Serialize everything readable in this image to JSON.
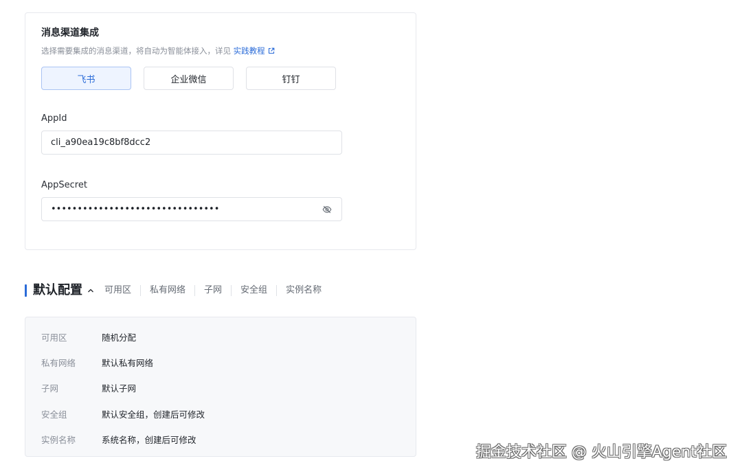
{
  "channel_card": {
    "title": "消息渠道集成",
    "description": "选择需要集成的消息渠道，将自动为智能体接入，详见",
    "tutorial_link": "实践教程",
    "tabs": [
      {
        "label": "飞书",
        "active": true
      },
      {
        "label": "企业微信",
        "active": false
      },
      {
        "label": "钉钉",
        "active": false
      }
    ],
    "app_id": {
      "label": "AppId",
      "value": "cli_a90ea19c8bf8dcc2"
    },
    "app_secret": {
      "label": "AppSecret",
      "masked_value": "••••••••••••••••••••••••••••••••"
    }
  },
  "default_config": {
    "title": "默认配置",
    "summary_items": [
      "可用区",
      "私有网络",
      "子网",
      "安全组",
      "实例名称"
    ],
    "rows": [
      {
        "key": "可用区",
        "value": "随机分配"
      },
      {
        "key": "私有网络",
        "value": "默认私有网络"
      },
      {
        "key": "子网",
        "value": "默认子网"
      },
      {
        "key": "安全组",
        "value": "默认安全组，创建后可修改"
      },
      {
        "key": "实例名称",
        "value": "系统名称，创建后可修改"
      }
    ]
  },
  "watermark": "掘金技术社区 @ 火山引擎Agent社区",
  "colors": {
    "accent": "#2a6bd8",
    "active_tab_bg": "#eef4ff",
    "config_bg": "#f7f8fa"
  },
  "icons": {
    "external_link": "external-link-icon",
    "visibility": "eye-off-icon",
    "collapse": "chevron-up-icon"
  }
}
